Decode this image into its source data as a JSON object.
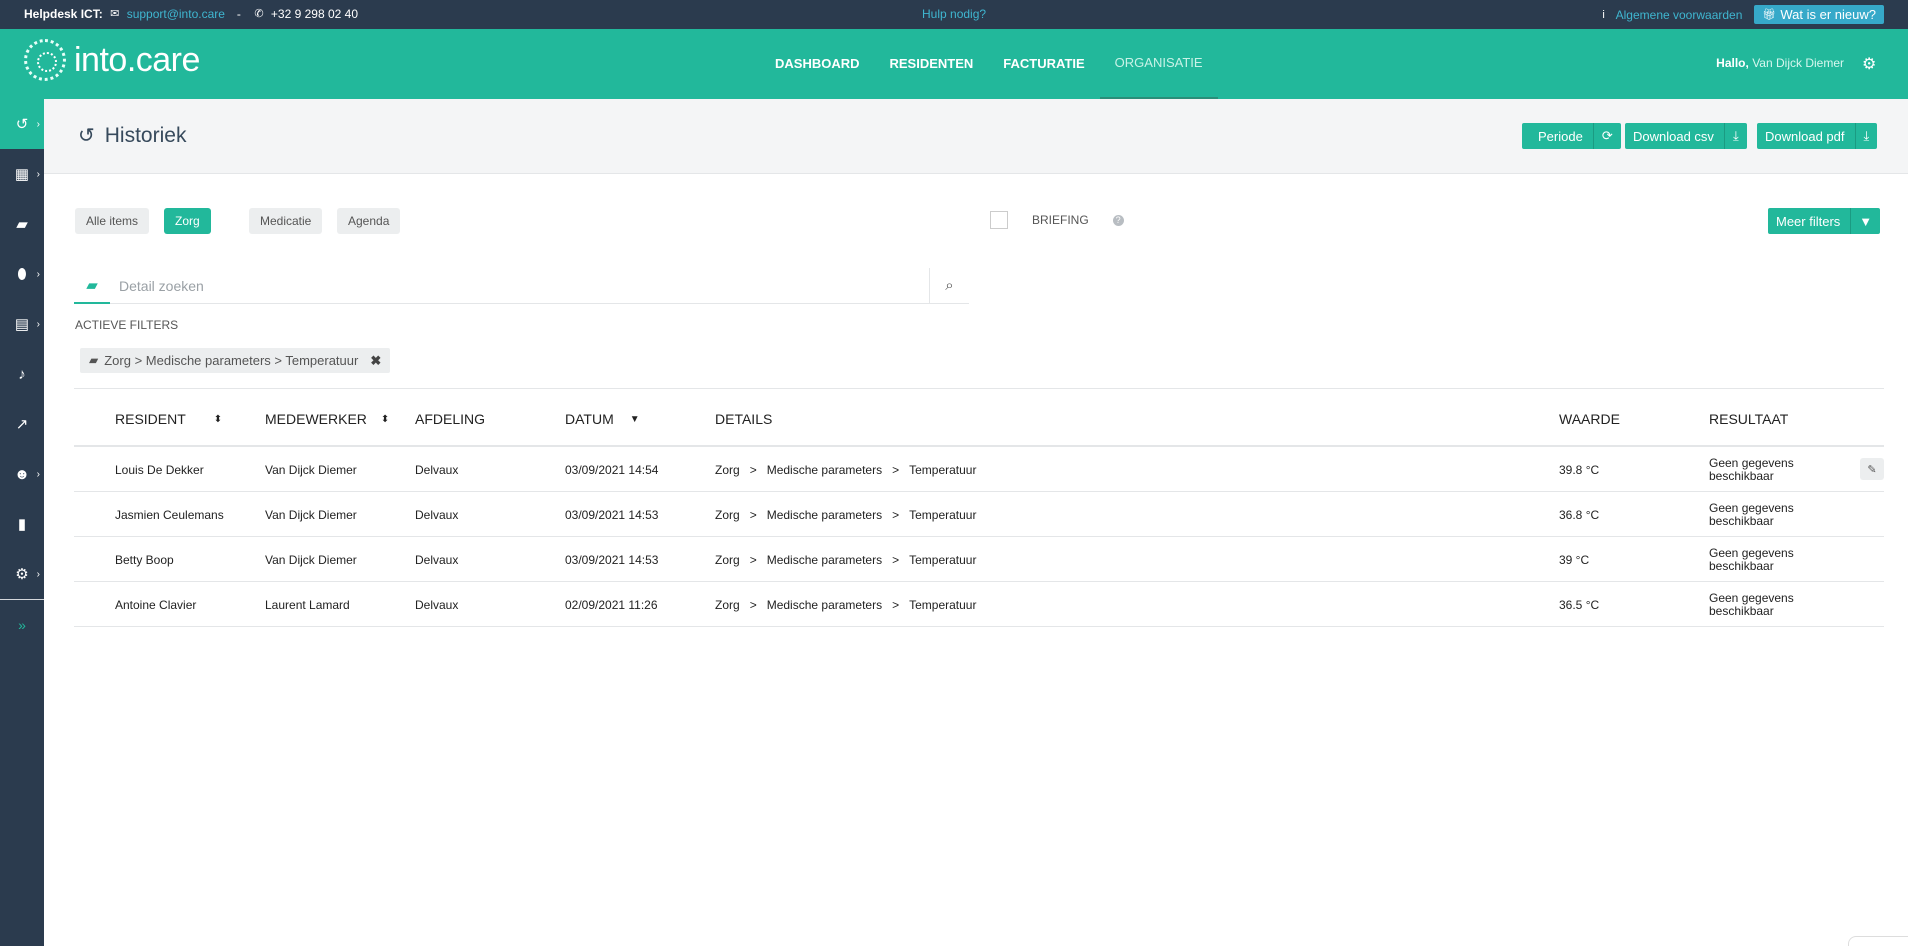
{
  "topbar": {
    "helpdesk_label": "Helpdesk ICT:",
    "email": "support@into.care",
    "dash": "-",
    "phone": "+32 9 298 02 40",
    "help": "Hulp nodig?",
    "terms": "Algemene voorwaarden",
    "whatsnew": "Wat is er nieuw?"
  },
  "header": {
    "logo_text": "into.care",
    "nav": [
      "DASHBOARD",
      "RESIDENTEN",
      "FACTURATIE",
      "ORGANISATIE"
    ],
    "active_nav": "ORGANISATIE",
    "hello": "Hallo,",
    "user": "Van Dijck Diemer"
  },
  "page": {
    "title": "Historiek",
    "buttons": {
      "period": "Periode",
      "csv": "Download csv",
      "pdf": "Download pdf"
    }
  },
  "filters": {
    "chips": [
      "Alle items",
      "Zorg",
      "Medicatie",
      "Agenda"
    ],
    "active_chip": "Zorg",
    "briefing": "BRIEFING",
    "more": "Meer filters",
    "search_placeholder": "Detail zoeken",
    "active_label": "ACTIEVE FILTERS",
    "active_tag": "Zorg > Medische parameters > Temperatuur"
  },
  "table": {
    "headers": [
      "RESIDENT",
      "MEDEWERKER",
      "AFDELING",
      "DATUM",
      "DETAILS",
      "WAARDE",
      "RESULTAAT"
    ],
    "rows": [
      {
        "resident": "Louis De Dekker",
        "medewerker": "Van Dijck Diemer",
        "afdeling": "Delvaux",
        "datum": "03/09/2021 14:54",
        "d1": "Zorg",
        "d2": "Medische parameters",
        "d3": "Temperatuur",
        "waarde": "39.8 °C",
        "resultaat": "Geen gegevens beschikbaar"
      },
      {
        "resident": "Jasmien Ceulemans",
        "medewerker": "Van Dijck Diemer",
        "afdeling": "Delvaux",
        "datum": "03/09/2021 14:53",
        "d1": "Zorg",
        "d2": "Medische parameters",
        "d3": "Temperatuur",
        "waarde": "36.8 °C",
        "resultaat": "Geen gegevens beschikbaar"
      },
      {
        "resident": "Betty Boop",
        "medewerker": "Van Dijck Diemer",
        "afdeling": "Delvaux",
        "datum": "03/09/2021 14:53",
        "d1": "Zorg",
        "d2": "Medische parameters",
        "d3": "Temperatuur",
        "waarde": "39 °C",
        "resultaat": "Geen gegevens beschikbaar"
      },
      {
        "resident": "Antoine Clavier",
        "medewerker": "Laurent Lamard",
        "afdeling": "Delvaux",
        "datum": "02/09/2021 11:26",
        "d1": "Zorg",
        "d2": "Medische parameters",
        "d3": "Temperatuur",
        "waarde": "36.5 °C",
        "resultaat": "Geen gegevens beschikbaar"
      }
    ],
    "crumb_sep": ">"
  },
  "colors": {
    "brand": "#22b89b",
    "dark": "#2b3b4e",
    "link": "#3fb6d0"
  },
  "sidebar_icons": [
    "history-icon",
    "calendar-icon",
    "book-icon",
    "pill-icon",
    "document-icon",
    "bell-icon",
    "chart-icon",
    "users-icon",
    "building-icon",
    "settings-icon"
  ]
}
